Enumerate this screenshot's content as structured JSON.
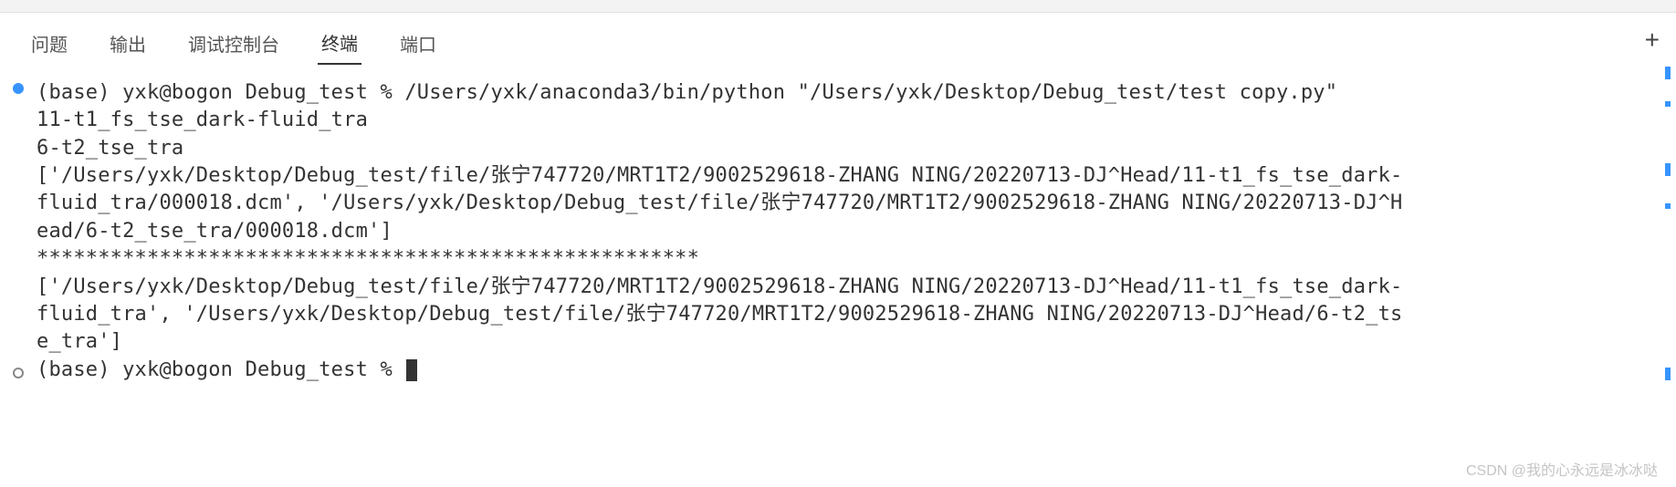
{
  "tabs": {
    "problems": "问题",
    "output": "输出",
    "debug_console": "调试控制台",
    "terminal": "终端",
    "ports": "端口"
  },
  "terminal": {
    "prompt1": "(base) yxk@bogon Debug_test % ",
    "command": "/Users/yxk/anaconda3/bin/python \"/Users/yxk/Desktop/Debug_test/test copy.py\"",
    "out_line1": "11-t1_fs_tse_dark-fluid_tra",
    "out_line2": "6-t2_tse_tra",
    "out_line3": "['/Users/yxk/Desktop/Debug_test/file/张宁747720/MRT1T2/9002529618-ZHANG NING/20220713-DJ^Head/11-t1_fs_tse_dark-fluid_tra/000018.dcm', '/Users/yxk/Desktop/Debug_test/file/张宁747720/MRT1T2/9002529618-ZHANG NING/20220713-DJ^Head/6-t2_tse_tra/000018.dcm']",
    "out_line4": "******************************************************",
    "out_line5": "['/Users/yxk/Desktop/Debug_test/file/张宁747720/MRT1T2/9002529618-ZHANG NING/20220713-DJ^Head/11-t1_fs_tse_dark-fluid_tra', '/Users/yxk/Desktop/Debug_test/file/张宁747720/MRT1T2/9002529618-ZHANG NING/20220713-DJ^Head/6-t2_tse_tra']",
    "prompt2": "(base) yxk@bogon Debug_test % "
  },
  "watermark": "CSDN @我的心永远是冰冰哒"
}
